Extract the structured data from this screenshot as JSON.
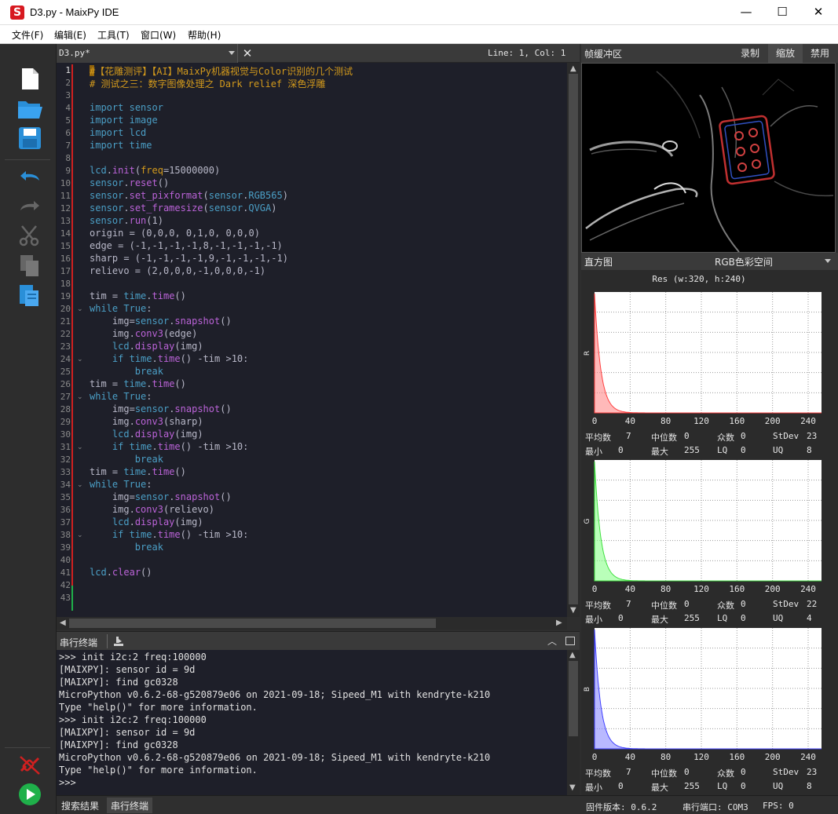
{
  "window": {
    "title": "D3.py - MaixPy IDE",
    "logo": "S",
    "minimize": "—",
    "maximize": "☐",
    "close": "✕"
  },
  "menu": [
    "文件(F)",
    "编辑(E)",
    "工具(T)",
    "窗口(W)",
    "帮助(H)"
  ],
  "toolbar_icons": [
    "new-file-icon",
    "open-folder-icon",
    "save-icon",
    "undo-icon",
    "redo-icon",
    "cut-icon",
    "copy-icon",
    "paste-icon",
    "disconnect-icon",
    "run-icon"
  ],
  "editor": {
    "file_name": "D3.py*",
    "close_label": "✕",
    "cursor_position": "Line: 1, Col: 1",
    "line_numbers": [
      "1",
      "2",
      "3",
      "4",
      "5",
      "6",
      "7",
      "8",
      "9",
      "10",
      "11",
      "12",
      "13",
      "14",
      "15",
      "16",
      "17",
      "18",
      "19",
      "20",
      "21",
      "22",
      "23",
      "24",
      "25",
      "26",
      "27",
      "28",
      "29",
      "30",
      "31",
      "32",
      "33",
      "34",
      "35",
      "36",
      "37",
      "38",
      "39",
      "40",
      "41",
      "42",
      "43"
    ],
    "fold_markers": {
      "20": "⌄",
      "24": "⌄",
      "27": "⌄",
      "31": "⌄",
      "34": "⌄",
      "38": "⌄"
    },
    "code_lines": [
      "#【花雕测评】【AI】MaixPy机器视觉与Color识别的几个测试",
      "# 测试之三：数字图像处理之 Dark relief 深色浮雕",
      "",
      "import sensor",
      "import image",
      "import lcd",
      "import time",
      "",
      "lcd.init(freq=15000000)",
      "sensor.reset()",
      "sensor.set_pixformat(sensor.RGB565)",
      "sensor.set_framesize(sensor.QVGA)",
      "sensor.run(1)",
      "origin = (0,0,0, 0,1,0, 0,0,0)",
      "edge = (-1,-1,-1,-1,8,-1,-1,-1,-1)",
      "sharp = (-1,-1,-1,-1,9,-1,-1,-1,-1)",
      "relievo = (2,0,0,0,-1,0,0,0,-1)",
      "",
      "tim = time.time()",
      "while True:",
      "    img=sensor.snapshot()",
      "    img.conv3(edge)",
      "    lcd.display(img)",
      "    if time.time() -tim >10:",
      "        break",
      "tim = time.time()",
      "while True:",
      "    img=sensor.snapshot()",
      "    img.conv3(sharp)",
      "    lcd.display(img)",
      "    if time.time() -tim >10:",
      "        break",
      "tim = time.time()",
      "while True:",
      "    img=sensor.snapshot()",
      "    img.conv3(relievo)",
      "    lcd.display(img)",
      "    if time.time() -tim >10:",
      "        break",
      "",
      "lcd.clear()",
      "",
      ""
    ]
  },
  "terminal": {
    "title": "串行终端",
    "lines": [
      ">>> init i2c:2 freq:100000",
      "[MAIXPY]: sensor id = 9d",
      "[MAIXPY]: find gc0328",
      "MicroPython v0.6.2-68-g520879e06 on 2021-09-18; Sipeed_M1 with kendryte-k210",
      "Type \"help()\" for more information.",
      ">>> init i2c:2 freq:100000",
      "[MAIXPY]: sensor id = 9d",
      "[MAIXPY]: find gc0328",
      "MicroPython v0.6.2-68-g520879e06 on 2021-09-18; Sipeed_M1 with kendryte-k210",
      "Type \"help()\" for more information.",
      ">>>"
    ]
  },
  "bottom_tabs": [
    "搜索结果",
    "串行终端"
  ],
  "status": {
    "firmware": "固件版本: 0.6.2",
    "serial_port": "串行端口: COM3",
    "fps": "FPS: 0"
  },
  "framebuffer": {
    "title": "帧缓冲区",
    "buttons": [
      "录制",
      "缩放",
      "禁用"
    ]
  },
  "histogram": {
    "title": "直方图",
    "color_space": "RGB色彩空间",
    "resolution": "Res (w:320, h:240)",
    "x_ticks": [
      "0",
      "40",
      "80",
      "120",
      "160",
      "200",
      "240"
    ],
    "channels": [
      {
        "name": "R",
        "color": "#ff8080",
        "edge": "#ff4040",
        "stats": {
          "mean_label": "平均数",
          "mean": "7",
          "median_label": "中位数",
          "median": "0",
          "mode_label": "众数",
          "mode": "0",
          "stdev_label": "StDev",
          "stdev": "23",
          "min_label": "最小",
          "min": "0",
          "max_label": "最大",
          "max": "255",
          "lq_label": "LQ",
          "lq": "0",
          "uq_label": "UQ",
          "uq": "8"
        }
      },
      {
        "name": "G",
        "color": "#80ff80",
        "edge": "#40e040",
        "stats": {
          "mean_label": "平均数",
          "mean": "7",
          "median_label": "中位数",
          "median": "0",
          "mode_label": "众数",
          "mode": "0",
          "stdev_label": "StDev",
          "stdev": "22",
          "min_label": "最小",
          "min": "0",
          "max_label": "最大",
          "max": "255",
          "lq_label": "LQ",
          "lq": "0",
          "uq_label": "UQ",
          "uq": "4"
        }
      },
      {
        "name": "B",
        "color": "#8080ff",
        "edge": "#4040ff",
        "stats": {
          "mean_label": "平均数",
          "mean": "7",
          "median_label": "中位数",
          "median": "0",
          "mode_label": "众数",
          "mode": "0",
          "stdev_label": "StDev",
          "stdev": "23",
          "min_label": "最小",
          "min": "0",
          "max_label": "最大",
          "max": "255",
          "lq_label": "LQ",
          "lq": "0",
          "uq_label": "UQ",
          "uq": "8"
        }
      }
    ]
  }
}
